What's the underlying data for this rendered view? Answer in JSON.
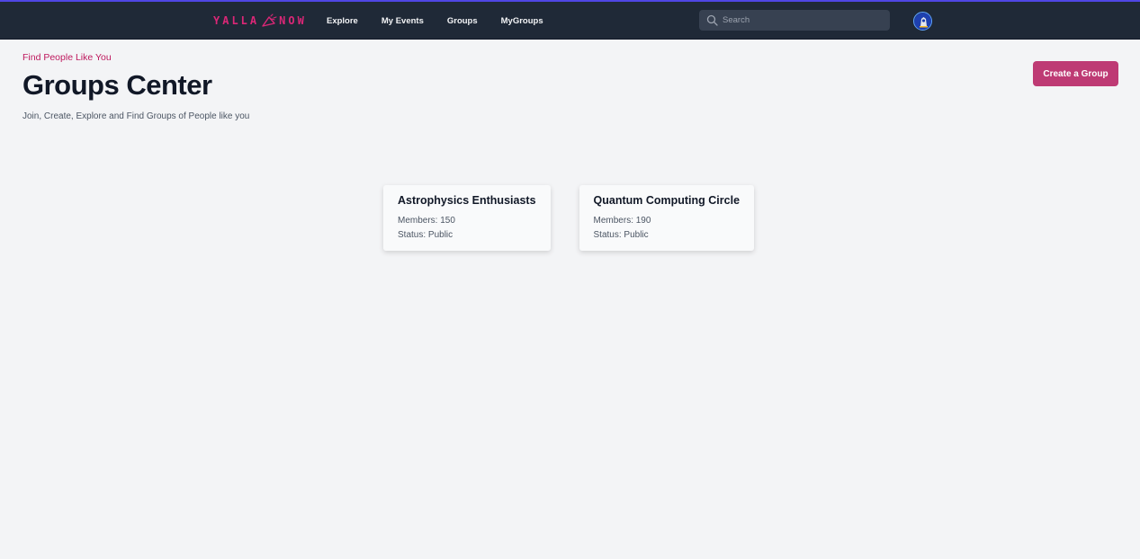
{
  "brand": {
    "name": "YALLA NOW",
    "accent": "#db2777"
  },
  "nav": {
    "links": [
      "Explore",
      "My Events",
      "Groups",
      "MyGroups"
    ],
    "search_placeholder": "Search",
    "background": "#1f2937"
  },
  "header": {
    "eyebrow": "Find People Like You",
    "title": "Groups Center",
    "subtitle": "Join, Create, Explore and Find Groups of People like you",
    "create_button": "Create a Group"
  },
  "groups": [
    {
      "name": "Astrophysics Enthusiasts",
      "members": "Members: 150",
      "status": "Status: Public"
    },
    {
      "name": "Quantum Computing Circle",
      "members": "Members: 190",
      "status": "Status: Public"
    }
  ]
}
